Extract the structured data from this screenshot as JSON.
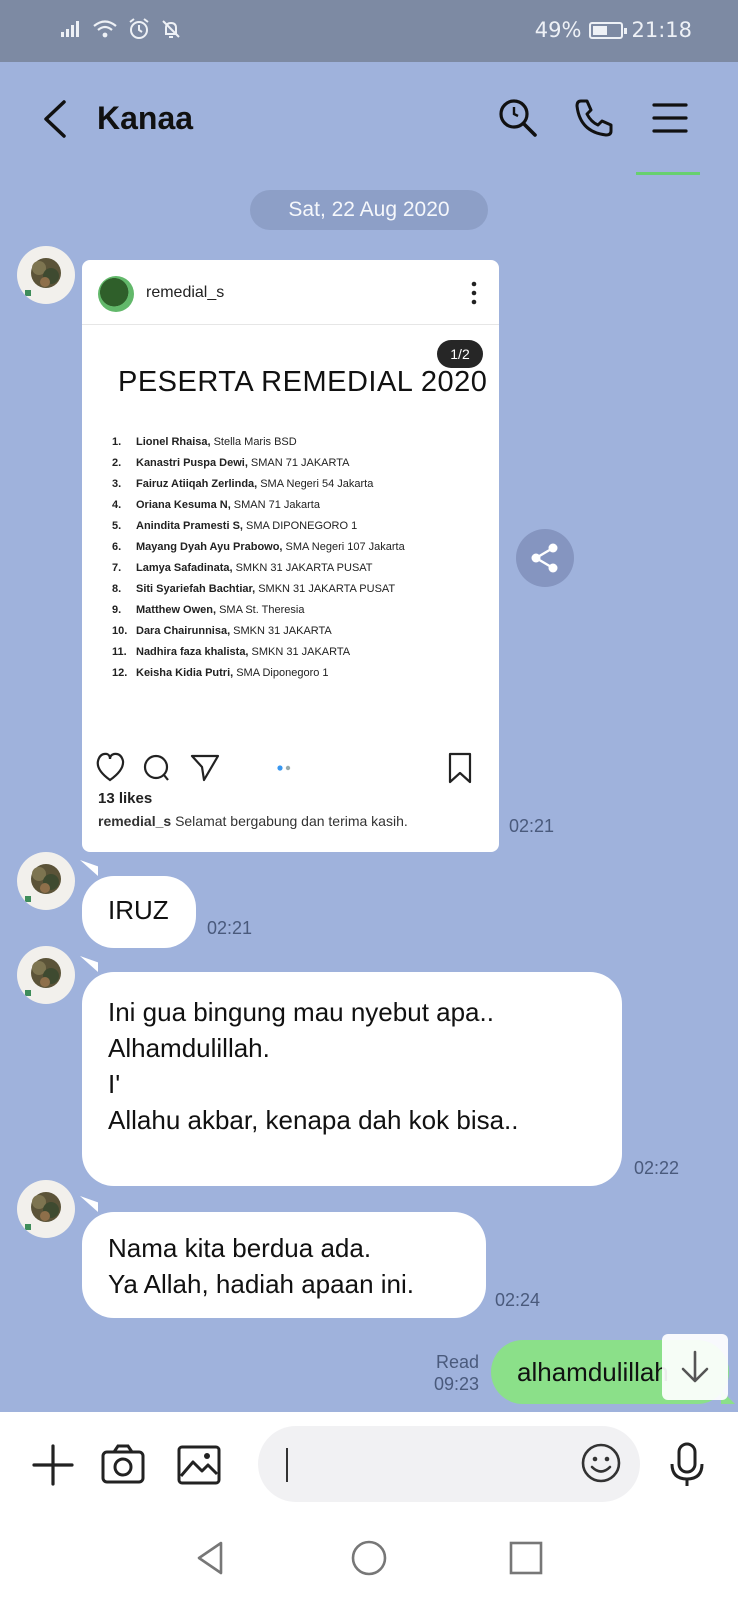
{
  "status_bar": {
    "battery": "49%",
    "time": "21:18"
  },
  "header": {
    "title": "Kanaa"
  },
  "date_chip": "Sat, 22 Aug 2020",
  "image_message": {
    "post": {
      "username": "remedial_s",
      "page_indicator": "1/2",
      "heading": "PESERTA REMEDIAL 2020",
      "list": [
        {
          "num": "1.",
          "name": "Lionel Rhaisa,",
          "school": "Stella Maris BSD"
        },
        {
          "num": "2.",
          "name": "Kanastri Puspa Dewi,",
          "school": "SMAN 71 JAKARTA"
        },
        {
          "num": "3.",
          "name": "Fairuz Atiiqah Zerlinda,",
          "school": "SMA Negeri 54 Jakarta"
        },
        {
          "num": "4.",
          "name": "Oriana Kesuma N,",
          "school": "SMAN 71 Jakarta"
        },
        {
          "num": "5.",
          "name": "Anindita Pramesti S,",
          "school": "SMA DIPONEGORO 1"
        },
        {
          "num": "6.",
          "name": "Mayang Dyah Ayu Prabowo,",
          "school": "SMA Negeri 107 Jakarta"
        },
        {
          "num": "7.",
          "name": "Lamya Safadinata,",
          "school": "SMKN 31 JAKARTA PUSAT"
        },
        {
          "num": "8.",
          "name": "Siti Syariefah Bachtiar,",
          "school": "SMKN 31 JAKARTA PUSAT"
        },
        {
          "num": "9.",
          "name": "Matthew Owen,",
          "school": "SMA St. Theresia"
        },
        {
          "num": "10.",
          "name": "Dara Chairunnisa,",
          "school": "SMKN 31 JAKARTA"
        },
        {
          "num": "11.",
          "name": "Nadhira faza khalista,",
          "school": "SMKN 31 JAKARTA"
        },
        {
          "num": "12.",
          "name": "Keisha Kidia Putri,",
          "school": "SMA Diponegoro 1"
        }
      ],
      "likes": "13 likes",
      "caption_user": "remedial_s",
      "caption_text": "Selamat bergabung dan terima kasih."
    },
    "time": "02:21"
  },
  "messages": [
    {
      "text": "IRUZ",
      "time": "02:21"
    },
    {
      "lines": [
        "Ini gua bingung mau nyebut apa..",
        "Alhamdulillah.",
        "I'",
        "Allahu akbar, kenapa dah kok bisa.."
      ],
      "time": "02:22"
    },
    {
      "lines": [
        "Nama kita berdua ada.",
        "Ya Allah, hadiah apaan ini."
      ],
      "time": "02:24"
    }
  ],
  "my_message": {
    "text": "alhamdulillah",
    "read_label": "Read",
    "time": "09:23"
  },
  "input": {
    "value": "",
    "placeholder": ""
  },
  "colors": {
    "chat_bg": "#9fb2dc",
    "status_bar": "#7d8aa3",
    "my_bubble": "#8be089",
    "accent_green": "#67d06e"
  }
}
